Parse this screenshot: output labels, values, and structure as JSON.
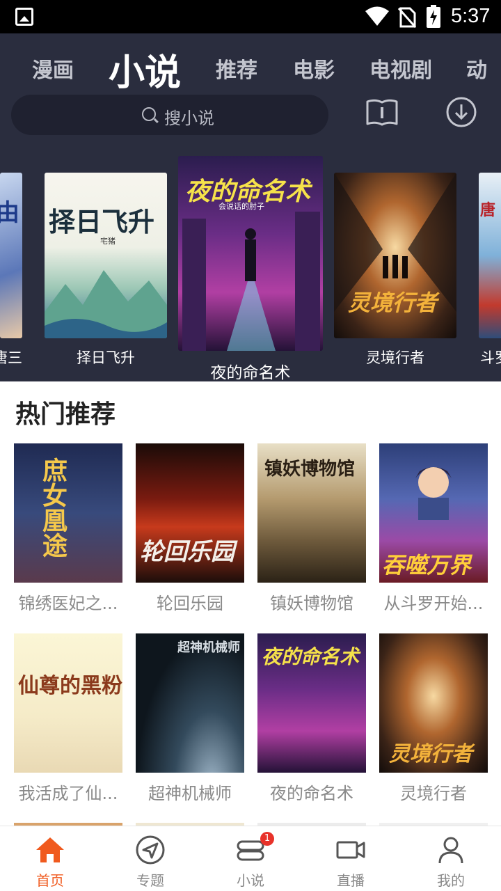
{
  "status_bar": {
    "time": "5:37",
    "icons": [
      "gallery-icon",
      "wifi-icon",
      "no-sim-icon",
      "battery-charging-icon"
    ]
  },
  "top_tabs": [
    {
      "label": "漫画",
      "active": false
    },
    {
      "label": "小说",
      "active": true
    },
    {
      "label": "推荐",
      "active": false
    },
    {
      "label": "电影",
      "active": false
    },
    {
      "label": "电视剧",
      "active": false
    },
    {
      "label": "动",
      "active": false
    }
  ],
  "search": {
    "placeholder": "搜小说",
    "icon": "search-icon"
  },
  "header_actions": {
    "bookshelf_icon": "book-icon",
    "download_icon": "download-icon"
  },
  "carousel": {
    "items": [
      {
        "label": "唐三",
        "cover_text": "由"
      },
      {
        "label": "择日飞升",
        "cover_text": "择日飞升",
        "cover_author": "宅猪"
      },
      {
        "label": "夜的命名术",
        "cover_text": "夜的命名术",
        "cover_author": "会说话的肘子",
        "featured": true
      },
      {
        "label": "灵境行者",
        "cover_text": "灵境行者"
      },
      {
        "label": "斗罗",
        "cover_text": "唐"
      }
    ]
  },
  "hot_section": {
    "title": "热门推荐",
    "books": [
      {
        "title": "锦绣医妃之...",
        "cover_text": "庶女凰途"
      },
      {
        "title": "轮回乐园",
        "cover_text": "轮回乐园"
      },
      {
        "title": "镇妖博物馆",
        "cover_text": "镇妖博物馆"
      },
      {
        "title": "从斗罗开始...",
        "cover_text": "吞噬万界"
      },
      {
        "title": "我活成了仙...",
        "cover_text": "仙尊的黑粉"
      },
      {
        "title": "超神机械师",
        "cover_text": "超神机械师"
      },
      {
        "title": "夜的命名术",
        "cover_text": "夜的命名术"
      },
      {
        "title": "灵境行者",
        "cover_text": "灵境行者"
      }
    ]
  },
  "bottom_nav": [
    {
      "label": "首页",
      "icon": "home-icon",
      "active": true
    },
    {
      "label": "专题",
      "icon": "compass-icon",
      "active": false
    },
    {
      "label": "小说",
      "icon": "novel-icon",
      "active": false,
      "badge": "1"
    },
    {
      "label": "直播",
      "icon": "video-camera-icon",
      "active": false
    },
    {
      "label": "我的",
      "icon": "profile-icon",
      "active": false
    }
  ],
  "colors": {
    "header_bg": "#2a2d3e",
    "accent": "#f05a1e",
    "badge": "#e8322a"
  }
}
